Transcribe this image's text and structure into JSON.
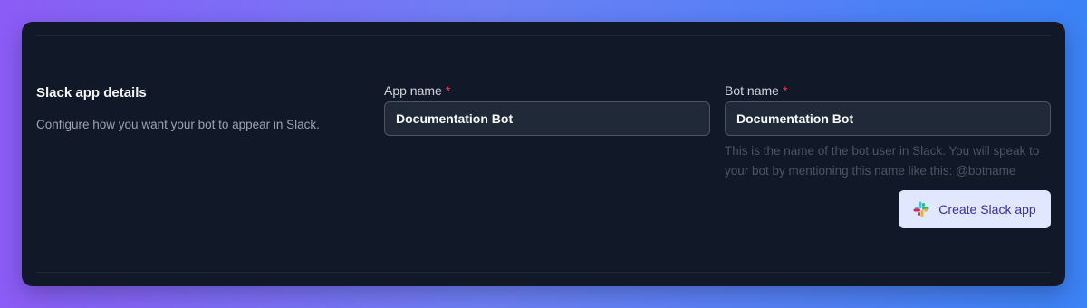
{
  "section": {
    "title": "Slack app details",
    "description": "Configure how you want your bot to appear in Slack."
  },
  "app_name": {
    "label": "App name",
    "required_marker": "*",
    "value": "Documentation Bot"
  },
  "bot_name": {
    "label": "Bot name",
    "required_marker": "*",
    "value": "Documentation Bot",
    "help": "This is the name of the bot user in Slack. You will speak to your bot by mentioning this name like this: @botname"
  },
  "create_button": {
    "label": "Create Slack app",
    "icon": "slack-logo-icon"
  },
  "colors": {
    "background_gradient_start": "#8b5cf6",
    "background_gradient_end": "#3b82f6",
    "card": "#111827",
    "input_bg": "#1f2937",
    "required": "#ef4444",
    "button_bg": "#e0e7ff",
    "button_text": "#3730a3"
  }
}
